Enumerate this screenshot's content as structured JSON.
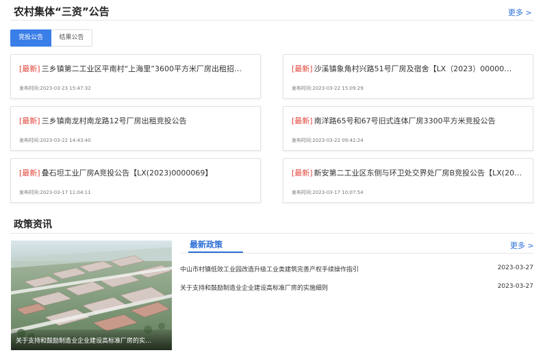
{
  "announcements": {
    "title": "农村集体“三资”公告",
    "more_label": "更多 >",
    "tabs": [
      {
        "label": "竞投公告",
        "active": true
      },
      {
        "label": "结果公告",
        "active": false
      }
    ],
    "tag_label": "[最新]",
    "date_prefix": "发布时间:",
    "items": [
      {
        "title": "三乡镇第二工业区平南村“上海里”3600平方米厂房出租招…",
        "date": "2023-03-23 15:47:32"
      },
      {
        "title": "沙溪镇象角村兴路51号厂房及宿舍【LX（2023）00000…",
        "date": "2023-03-22 15:09:29"
      },
      {
        "title": "三乡镇南龙村南龙路12号厂房出租竞投公告",
        "date": "2023-03-22 14:43:40"
      },
      {
        "title": "南洋路65号和67号旧式连体厂房3300平方米竞投公告",
        "date": "2023-03-22 09:42:24"
      },
      {
        "title": "叠石坦工业厂房A竞投公告【LX(2023)0000069】",
        "date": "2023-03-17 11:04:11"
      },
      {
        "title": "新安第二工业区东侧与环卫处交界处厂房B竞投公告【LX(20…",
        "date": "2023-03-17 10:07:54"
      }
    ]
  },
  "policy": {
    "title": "政策资讯",
    "photo_caption": "关于支持和鼓励制造业企业建设高标准厂房的实…",
    "tab_label": "最新政策",
    "more_label": "更多 >",
    "items": [
      {
        "title": "中山市村镇低效工业园改造升级工业类建筑完善产权手续操作指引",
        "date": "2023-03-27"
      },
      {
        "title": "关于支持和鼓励制造业企业建设高标准厂房的实施细则",
        "date": "2023-03-27"
      }
    ]
  },
  "colors": {
    "accent": "#2b6fd6",
    "tab_active": "#3a7ee8",
    "tag_red": "#e2443a"
  }
}
